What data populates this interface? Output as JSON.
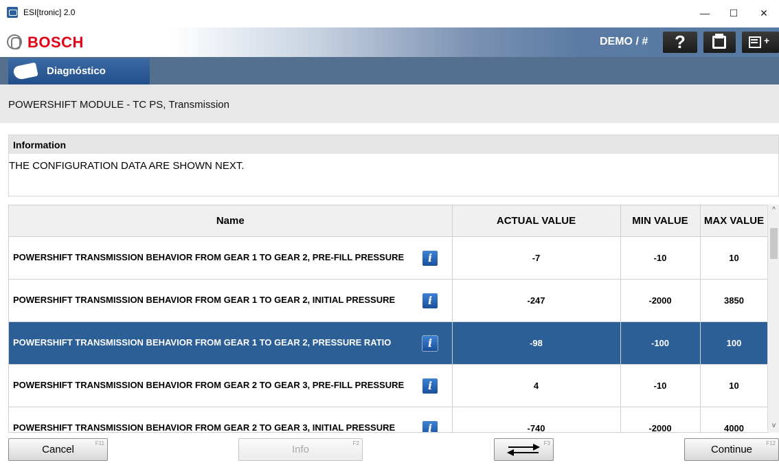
{
  "window": {
    "title": "ESI[tronic] 2.0",
    "minimize_glyph": "—",
    "maximize_glyph": "☐",
    "close_glyph": "✕"
  },
  "header": {
    "brand": "BOSCH",
    "user_label": "DEMO / #",
    "help_glyph": "?",
    "exit_glyph": "+"
  },
  "tabs": [
    {
      "label": "Diagnóstico",
      "icon": "car-plug-icon"
    }
  ],
  "module": {
    "title": "POWERSHIFT MODULE - TC PS, Transmission"
  },
  "information": {
    "heading": "Information",
    "text": "THE CONFIGURATION DATA ARE SHOWN NEXT."
  },
  "table": {
    "columns": [
      "Name",
      "ACTUAL VALUE",
      "MIN VALUE",
      "MAX VALUE"
    ],
    "info_glyph": "i",
    "rows": [
      {
        "name": "POWERSHIFT TRANSMISSION BEHAVIOR FROM GEAR 1 TO GEAR 2, PRE-FILL PRESSURE",
        "actual": "-7",
        "min": "-10",
        "max": "10"
      },
      {
        "name": "POWERSHIFT TRANSMISSION BEHAVIOR FROM GEAR 1 TO GEAR 2, INITIAL PRESSURE",
        "actual": "-247",
        "min": "-2000",
        "max": "3850"
      },
      {
        "name": "POWERSHIFT TRANSMISSION BEHAVIOR FROM GEAR 1 TO GEAR 2, PRESSURE RATIO",
        "actual": "-98",
        "min": "-100",
        "max": "100"
      },
      {
        "name": "POWERSHIFT TRANSMISSION BEHAVIOR FROM GEAR 2 TO GEAR 3, PRE-FILL PRESSURE",
        "actual": "4",
        "min": "-10",
        "max": "10"
      },
      {
        "name": "POWERSHIFT TRANSMISSION BEHAVIOR FROM GEAR 2 TO GEAR 3, INITIAL PRESSURE",
        "actual": "-740",
        "min": "-2000",
        "max": "4000"
      }
    ],
    "selected_index": 2
  },
  "scrollbar": {
    "up_glyph": "^",
    "down_glyph": "v"
  },
  "footer": {
    "cancel": {
      "label": "Cancel",
      "key": "F11"
    },
    "info": {
      "label": "Info",
      "key": "F2"
    },
    "switch": {
      "key": "F3"
    },
    "continue": {
      "label": "Continue",
      "key": "F12"
    }
  }
}
